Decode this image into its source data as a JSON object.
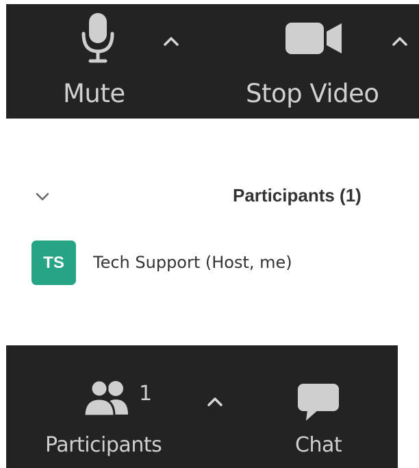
{
  "toolbar_top": {
    "mute_label": "Mute",
    "stop_video_label": "Stop Video",
    "icons": {
      "mute": "microphone-icon",
      "mute_options": "caret-up-icon",
      "video": "video-camera-icon",
      "video_options": "caret-up-icon"
    }
  },
  "participants_panel": {
    "title": "Participants (1)",
    "collapse_icon": "chevron-down-icon",
    "participants": [
      {
        "initials": "TS",
        "name": "Tech Support (Host, me)",
        "avatar_color": "#27a386"
      }
    ]
  },
  "toolbar_bottom": {
    "participants_label": "Participants",
    "participants_count": "1",
    "chat_label": "Chat",
    "icons": {
      "participants": "participants-icon",
      "participants_options": "caret-up-icon",
      "chat": "chat-bubble-icon"
    }
  },
  "colors": {
    "toolbar_bg": "#232323",
    "toolbar_text": "#d0d0d0",
    "avatar_bg": "#27a386",
    "panel_text": "#333333"
  }
}
